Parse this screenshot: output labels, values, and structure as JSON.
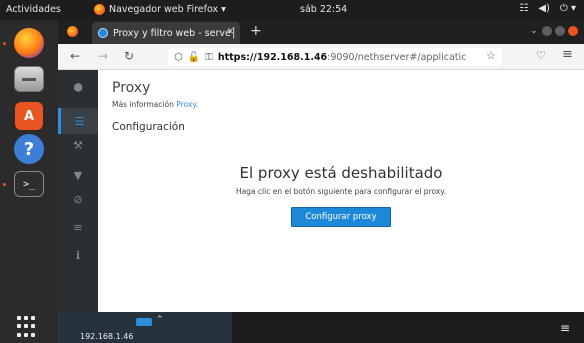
{
  "topbar": {
    "activities": "Actividades",
    "app_name": "Navegador web Firefox ▾",
    "clock": "sáb 22:54",
    "tray": [
      "☷",
      "◀)",
      "⏻ ▾"
    ]
  },
  "browser": {
    "tab_title": "Proxy y filtro web - serve│",
    "tab_close": "✕",
    "new_tab": "+",
    "tab_menu": "⌄",
    "back": "←",
    "forward": "→",
    "reload": "↻",
    "url_host": "https://192.168.1.46",
    "url_path": ":9090/nethserver#/applicatic",
    "shield_icon": "⬡",
    "bookmark_icon": "☆",
    "pocket_icon": "♡",
    "menu_icon": "≡"
  },
  "cockpit_sidebar": [
    {
      "icon": "cube-icon",
      "glyph": "⬢"
    },
    {
      "icon": "list-icon",
      "glyph": "☰",
      "active": true
    },
    {
      "icon": "wrench-icon",
      "glyph": "⚒"
    },
    {
      "icon": "filter-icon",
      "glyph": "▼"
    },
    {
      "icon": "ban-icon",
      "glyph": "⊘"
    },
    {
      "icon": "log-icon",
      "glyph": "≡"
    },
    {
      "icon": "info-icon",
      "glyph": "ℹ"
    }
  ],
  "page": {
    "title": "Proxy",
    "more_info_prefix": "Más información ",
    "more_info_link": "Proxy",
    "more_info_suffix": ".",
    "section": "Configuración",
    "status": "El proxy está deshabilitado",
    "hint": "Haga clic en el botón siguiente para configurar el proxy.",
    "button": "Configurar proxy"
  },
  "taskbar": {
    "host": "192.168.1.46",
    "caret": "⌃",
    "menu": "≡"
  },
  "dock": {
    "store_glyph": "A",
    "help_glyph": "?",
    "term_glyph": ">_"
  }
}
